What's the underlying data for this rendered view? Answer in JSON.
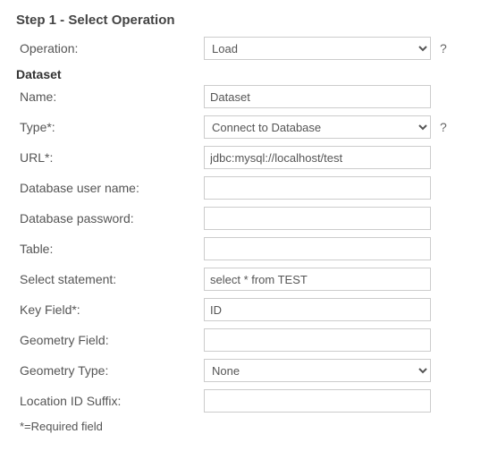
{
  "step": {
    "title": "Step 1 - Select Operation"
  },
  "operation": {
    "label": "Operation:",
    "value": "Load",
    "help": "?"
  },
  "dataset": {
    "title": "Dataset",
    "name": {
      "label": "Name:",
      "value": "Dataset"
    },
    "type": {
      "label": "Type*:",
      "value": "Connect to Database",
      "help": "?"
    },
    "url": {
      "label": "URL*:",
      "value": "jdbc:mysql://localhost/test"
    },
    "dbuser": {
      "label": "Database user name:",
      "value": ""
    },
    "dbpass": {
      "label": "Database password:",
      "value": ""
    },
    "table": {
      "label": "Table:",
      "value": ""
    },
    "select": {
      "label": "Select statement:",
      "value": "select * from TEST"
    },
    "keyfield": {
      "label": "Key Field*:",
      "value": "ID"
    },
    "geomfield": {
      "label": "Geometry Field:",
      "value": ""
    },
    "geomtype": {
      "label": "Geometry Type:",
      "value": "None"
    },
    "locsuffix": {
      "label": "Location ID Suffix:",
      "value": ""
    }
  },
  "footnote": "*=Required field"
}
